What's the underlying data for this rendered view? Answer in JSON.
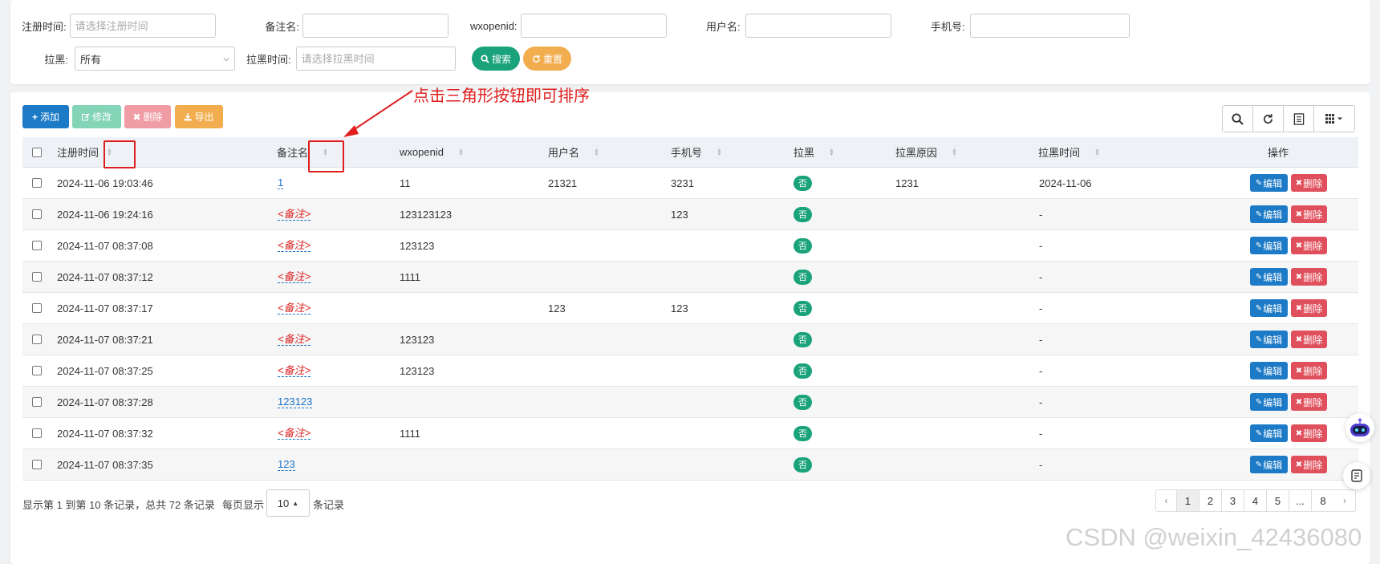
{
  "search": {
    "reg_time_label": "注册时间:",
    "reg_time_placeholder": "请选择注册时间",
    "remark_label": "备注名:",
    "wxopenid_label": "wxopenid:",
    "username_label": "用户名:",
    "phone_label": "手机号:",
    "blacklist_label": "拉黑:",
    "blacklist_value": "所有",
    "blacklist_time_label": "拉黑时间:",
    "blacklist_time_placeholder": "请选择拉黑时间",
    "search_btn": "搜索",
    "reset_btn": "重置"
  },
  "toolbar": {
    "add": "添加",
    "edit": "修改",
    "delete": "删除",
    "export": "导出"
  },
  "annotation": "点击三角形按钮即可排序",
  "table": {
    "headers": {
      "reg_time": "注册时间",
      "remark": "备注名",
      "wxopenid": "wxopenid",
      "username": "用户名",
      "phone": "手机号",
      "blacklist": "拉黑",
      "blacklist_reason": "拉黑原因",
      "blacklist_time": "拉黑时间",
      "actions": "操作"
    },
    "rows": [
      {
        "reg_time": "2024-11-06 19:03:46",
        "remark": "1",
        "remark_empty": false,
        "wxopenid": "11",
        "username": "21321",
        "phone": "3231",
        "blacklist": "否",
        "reason": "1231",
        "bl_time": "2024-11-06"
      },
      {
        "reg_time": "2024-11-06 19:24:16",
        "remark": "<备注>",
        "remark_empty": true,
        "wxopenid": "123123123",
        "username": "",
        "phone": "123",
        "blacklist": "否",
        "reason": "",
        "bl_time": "-"
      },
      {
        "reg_time": "2024-11-07 08:37:08",
        "remark": "<备注>",
        "remark_empty": true,
        "wxopenid": "123123",
        "username": "",
        "phone": "",
        "blacklist": "否",
        "reason": "",
        "bl_time": "-"
      },
      {
        "reg_time": "2024-11-07 08:37:12",
        "remark": "<备注>",
        "remark_empty": true,
        "wxopenid": "1111",
        "username": "",
        "phone": "",
        "blacklist": "否",
        "reason": "",
        "bl_time": "-"
      },
      {
        "reg_time": "2024-11-07 08:37:17",
        "remark": "<备注>",
        "remark_empty": true,
        "wxopenid": "",
        "username": "123",
        "phone": "123",
        "blacklist": "否",
        "reason": "",
        "bl_time": "-"
      },
      {
        "reg_time": "2024-11-07 08:37:21",
        "remark": "<备注>",
        "remark_empty": true,
        "wxopenid": "123123",
        "username": "",
        "phone": "",
        "blacklist": "否",
        "reason": "",
        "bl_time": "-"
      },
      {
        "reg_time": "2024-11-07 08:37:25",
        "remark": "<备注>",
        "remark_empty": true,
        "wxopenid": "123123",
        "username": "",
        "phone": "",
        "blacklist": "否",
        "reason": "",
        "bl_time": "-"
      },
      {
        "reg_time": "2024-11-07 08:37:28",
        "remark": "123123",
        "remark_empty": false,
        "wxopenid": "",
        "username": "",
        "phone": "",
        "blacklist": "否",
        "reason": "",
        "bl_time": "-"
      },
      {
        "reg_time": "2024-11-07 08:37:32",
        "remark": "<备注>",
        "remark_empty": true,
        "wxopenid": "1111",
        "username": "",
        "phone": "",
        "blacklist": "否",
        "reason": "",
        "bl_time": "-"
      },
      {
        "reg_time": "2024-11-07 08:37:35",
        "remark": "123",
        "remark_empty": false,
        "wxopenid": "",
        "username": "",
        "phone": "",
        "blacklist": "否",
        "reason": "",
        "bl_time": "-"
      }
    ],
    "row_edit": "编辑",
    "row_delete": "删除"
  },
  "footer": {
    "summary": "显示第 1 到第 10 条记录，总共 72 条记录",
    "per_page_prefix": "每页显示",
    "per_page_value": "10",
    "per_page_suffix": "条记录"
  },
  "pagination": {
    "prev": "‹",
    "pages": [
      "1",
      "2",
      "3",
      "4",
      "5",
      "...",
      "8"
    ],
    "active": "1",
    "next": "›"
  },
  "watermark": "CSDN @weixin_42436080",
  "colors": {
    "primary": "#1c7ac6",
    "success": "#1aa37a",
    "edit_disabled": "#84d4b8",
    "delete_disabled": "#f09ca4",
    "warning": "#f2ad4e",
    "danger": "#e0505c",
    "annotation": "#e01e1e"
  }
}
